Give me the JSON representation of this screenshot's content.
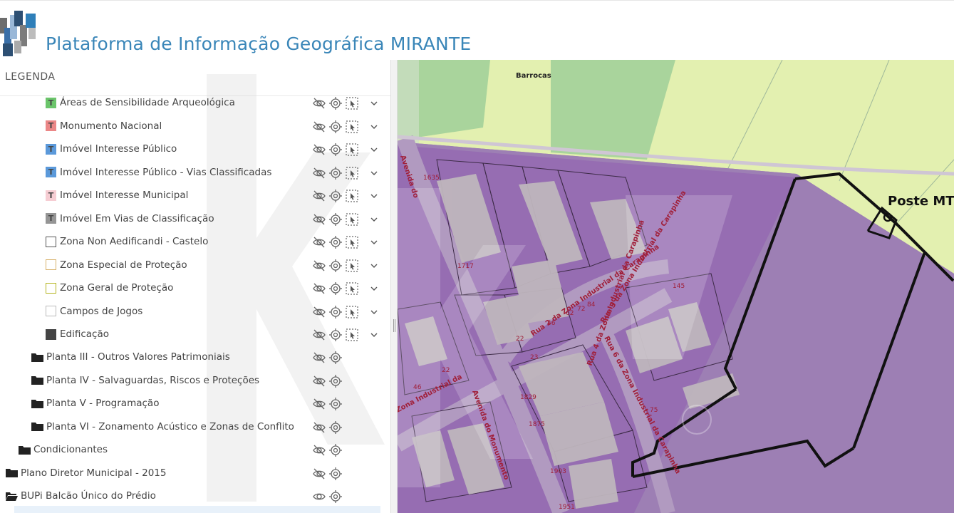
{
  "app": {
    "title": "Plataforma de Informação Geográfica MIRANTE"
  },
  "legend": {
    "header": "LEGENDA",
    "layers": [
      {
        "label": "Áreas de Sensibilidade Arqueológica",
        "symbol": "T",
        "color": "#5cbf5c",
        "kind": "t-layer"
      },
      {
        "label": "Monumento Nacional",
        "symbol": "T",
        "color": "#e97b7b",
        "kind": "t-layer"
      },
      {
        "label": "Imóvel Interesse Público",
        "symbol": "T",
        "color": "#4a8fd6",
        "kind": "t-layer"
      },
      {
        "label": "Imóvel Interesse Público - Vias Classificadas",
        "symbol": "T",
        "color": "#4a8fd6",
        "kind": "t-layer"
      },
      {
        "label": "Imóvel Interesse Municipal",
        "symbol": "T",
        "color": "#f6c8cf",
        "kind": "t-layer"
      },
      {
        "label": "Imóvel Em Vias de Classificação",
        "symbol": "T",
        "color": "#8a8a8a",
        "kind": "t-layer"
      },
      {
        "label": "Zona Non Aedificandi - Castelo",
        "symbol": "",
        "color": "#555555",
        "kind": "box"
      },
      {
        "label": "Zona Especial de Proteção",
        "symbol": "",
        "color": "#d7b16b",
        "kind": "box"
      },
      {
        "label": "Zona Geral de Proteção",
        "symbol": "",
        "color": "#b4b41e",
        "kind": "box"
      },
      {
        "label": "Campos de Jogos",
        "symbol": "",
        "color": "#bbbbbb",
        "kind": "box"
      },
      {
        "label": "Edificação",
        "symbol": "",
        "color": "#444444",
        "kind": "filled"
      }
    ],
    "folders": [
      {
        "label": "Planta III - Outros Valores Patrimoniais"
      },
      {
        "label": "Planta IV - Salvaguardas, Riscos e Proteções"
      },
      {
        "label": "Planta V - Programação"
      },
      {
        "label": "Planta VI - Zonamento Acústico e Zonas de Conflito"
      },
      {
        "label": "Condicionantes"
      },
      {
        "label": "Plano Diretor Municipal - 2015"
      },
      {
        "label": "BUPi Balcão Único do Prédio"
      }
    ]
  },
  "map": {
    "place_label": "Barrocas",
    "annotation": "Poste MT",
    "street_labels": [
      "Avenida do",
      "Avenida do Monumento",
      "Rua 3 da Zona Industrial da Carapinha",
      "Rua 6 da Zona Industrial da Carapinha",
      "Rua 4 da Zona Industrial da Carapinha",
      "Rua 2 da Zona Industrial da Carapinha",
      "Zona Industrial da",
      "Avenida do Monumento"
    ],
    "number_labels": [
      "1635",
      "1717",
      "46",
      "62",
      "72",
      "84",
      "145",
      "22",
      "23",
      "22",
      "46",
      "1829",
      "1875",
      "1903",
      "1951",
      "75"
    ],
    "colors": {
      "purple": "#9d7fb4",
      "green": "#a9d49c",
      "lightgreen": "#e3f0b0",
      "building": "#bfb6bd",
      "road_label": "#a0203a"
    }
  }
}
